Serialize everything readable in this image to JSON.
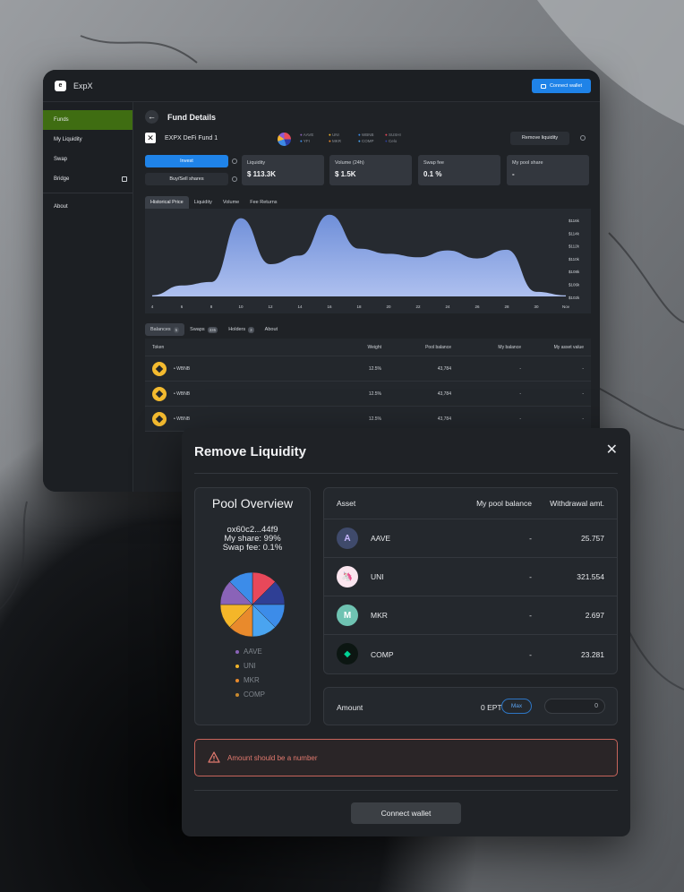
{
  "app": {
    "title": "ExpX",
    "connect_wallet": "Connect wallet",
    "sidebar": [
      {
        "label": "Funds",
        "active": true
      },
      {
        "label": "My Liquidity"
      },
      {
        "label": "Swap"
      },
      {
        "label": "Bridge"
      },
      {
        "label": "About"
      }
    ],
    "page_title": "Fund Details",
    "fund_name": "EXPX DeFi Fund 1",
    "fund_tokens": [
      "AAVE",
      "YFI",
      "UNI",
      "MKR",
      "WBNB",
      "COMP",
      "SUSHI",
      "Celo"
    ],
    "remove_liquidity": "Remove liquidity",
    "invest": "Invest",
    "buy_sell": "Buy/Sell shares",
    "stats": [
      {
        "label": "Liquidity",
        "value": "$ 113.3K"
      },
      {
        "label": "Volume (24h)",
        "value": "$ 1.5K"
      },
      {
        "label": "Swap fee",
        "value": "0.1 %"
      },
      {
        "label": "My pool share",
        "value": "-"
      }
    ],
    "chart_tabs": [
      "Historical Price",
      "Liquidity",
      "Volume",
      "Fee Returns"
    ],
    "table_tabs": [
      {
        "label": "Balances",
        "badge": "5"
      },
      {
        "label": "Swaps",
        "badge": "335"
      },
      {
        "label": "Holders",
        "badge": "3"
      },
      {
        "label": "About",
        "badge": ""
      }
    ],
    "table_headers": [
      "Token",
      "Weight",
      "Pool balance",
      "My balance",
      "My asset value"
    ],
    "table_rows": [
      {
        "token": "WBNB",
        "weight": "12.5%",
        "pool": "43,784",
        "my": "-",
        "value": "-"
      },
      {
        "token": "WBNB",
        "weight": "12.5%",
        "pool": "43,784",
        "my": "-",
        "value": "-"
      },
      {
        "token": "WBNB",
        "weight": "12.5%",
        "pool": "43,784",
        "my": "-",
        "value": "-"
      }
    ]
  },
  "chart_data": {
    "type": "area",
    "x": [
      "4",
      "6",
      "8",
      "10",
      "12",
      "14",
      "16",
      "18",
      "20",
      "22",
      "24",
      "26",
      "28",
      "30",
      "Nov"
    ],
    "values": [
      102.2,
      103.9,
      104.5,
      115.6,
      107.6,
      109.1,
      116.2,
      110.3,
      109.4,
      108.8,
      110.0,
      108.6,
      110.1,
      102.8,
      102.2
    ],
    "y_ticks": [
      "$116k",
      "$114k",
      "$112k",
      "$110k",
      "$108k",
      "$106k",
      "$102k"
    ],
    "ylim": [
      102,
      116
    ],
    "color": "#6f8fd9"
  },
  "modal": {
    "title": "Remove Liquidity",
    "close": "✕",
    "pool_overview_title": "Pool Overview",
    "pool_address": "ox60c2...44f9",
    "my_share": "My share: 99%",
    "swap_fee": "Swap fee: 0.1%",
    "legend": [
      {
        "name": "AAVE",
        "color": "#8a63b8"
      },
      {
        "name": "UNI",
        "color": "#f0b429"
      },
      {
        "name": "MKR",
        "color": "#e98a2c"
      },
      {
        "name": "COMP",
        "color": "#c88a2e"
      }
    ],
    "pie_slices": [
      "#e8485a",
      "#2f3f95",
      "#3c8ce9",
      "#4aa4f0",
      "#e98a2c",
      "#f4b629",
      "#8a63b8",
      "#3c8ce9"
    ],
    "asset_headers": [
      "Asset",
      "My pool balance",
      "Withdrawal amt."
    ],
    "assets": [
      {
        "name": "AAVE",
        "balance": "-",
        "withdraw": "25.757",
        "icon": "aave-icon"
      },
      {
        "name": "UNI",
        "balance": "-",
        "withdraw": "321.554",
        "icon": "uni-icon"
      },
      {
        "name": "MKR",
        "balance": "-",
        "withdraw": "2.697",
        "icon": "mkr-icon"
      },
      {
        "name": "COMP",
        "balance": "-",
        "withdraw": "23.281",
        "icon": "comp-icon"
      }
    ],
    "amount_label": "Amount",
    "amount_unit": "0 EPT",
    "max": "Max",
    "amount_value": "0",
    "alert": "Amount should be a number",
    "connect_wallet": "Connect wallet"
  }
}
